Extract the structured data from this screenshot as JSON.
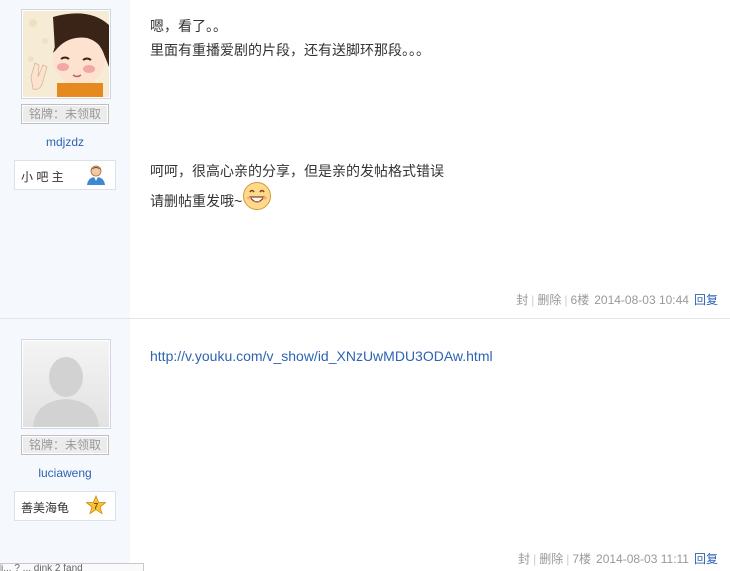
{
  "posts": [
    {
      "avatar": "cartoon-girl-avatar",
      "badge": "铭牌：未领取",
      "username": "mdjzdz",
      "role": "小 吧 主",
      "role_icon": "user-icon",
      "lines": [
        "嗯，看了。。",
        "里面有重播爱剧的片段，还有送脚环那段。。。",
        "呵呵，很高心亲的分享，但是亲的发帖格式错误",
        "请删帖重发哦~"
      ],
      "emoticon": "grinning-face-icon",
      "actions": {
        "ban": "封",
        "delete": "删除",
        "floor": "6楼",
        "date": "2014-08-03 10:44",
        "reply": "回复"
      }
    },
    {
      "avatar": "default-user-avatar",
      "badge": "铭牌：未领取",
      "username": "luciaweng",
      "role": "善美海龟",
      "role_icon": "level-7-star-icon",
      "role_level": "7",
      "link": "http://v.youku.com/v_show/id_XNzUwMDU3ODAw.html",
      "actions": {
        "ban": "封",
        "delete": "删除",
        "floor": "7楼",
        "date": "2014-08-03 11:11",
        "reply": "回复"
      }
    }
  ],
  "footer_strip": "i... ? ... dink 2 fand"
}
